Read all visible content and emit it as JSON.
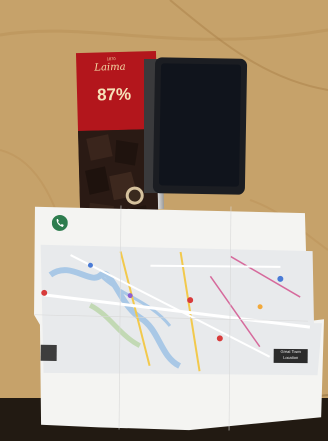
{
  "chocolate": {
    "brand": "Laima",
    "year": "1870",
    "percent": "87%"
  },
  "map": {
    "poi_label": "Great Town Location"
  },
  "colors": {
    "table": "#c9a66e",
    "wrapper_red": "#b3161c",
    "chocolate": "#2a1a14",
    "phone": "#1b1d22",
    "map_paper": "#f4f4f4",
    "map_water": "#a9c8e6",
    "map_green": "#b8d5a6",
    "map_icon": "#2e7d4f"
  }
}
